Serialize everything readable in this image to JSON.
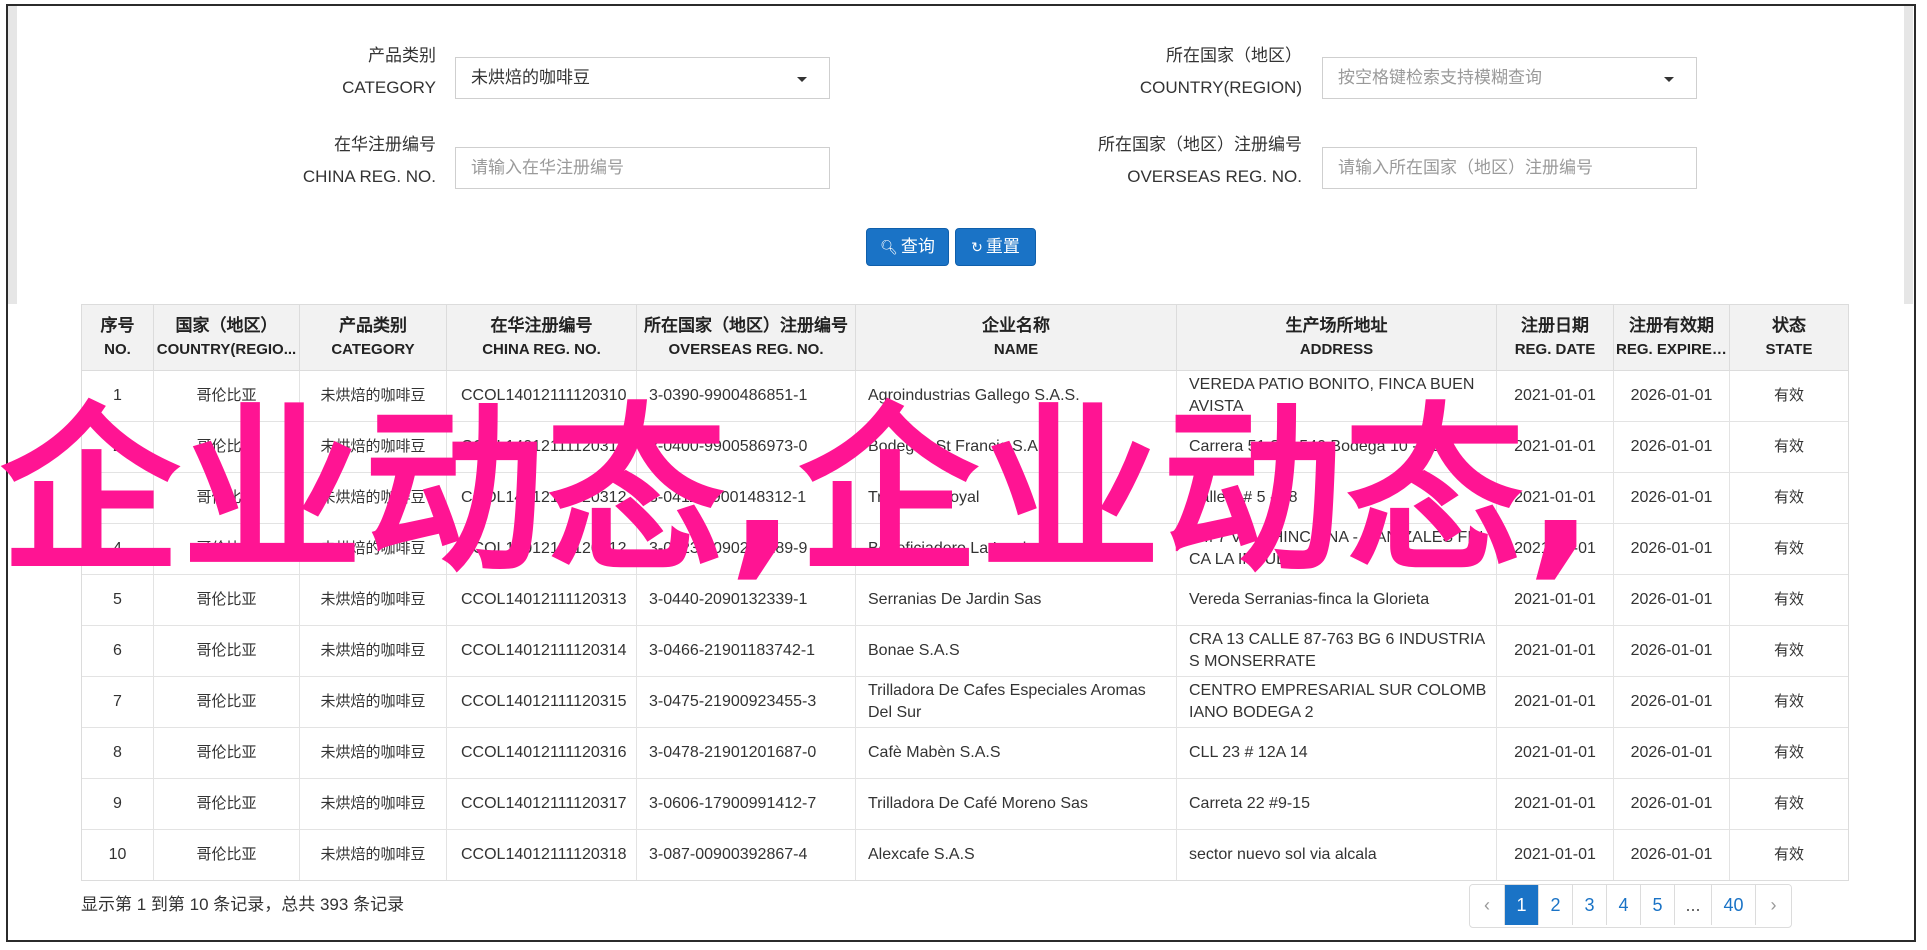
{
  "filters": {
    "category": {
      "label_zh": "产品类别",
      "label_en": "CATEGORY",
      "value": "未烘焙的咖啡豆"
    },
    "country": {
      "label_zh": "所在国家（地区）",
      "label_en": "COUNTRY(REGION)",
      "placeholder": "按空格键检索支持模糊查询"
    },
    "china_reg": {
      "label_zh": "在华注册编号",
      "label_en": "CHINA REG. NO.",
      "placeholder": "请输入在华注册编号"
    },
    "overseas_reg": {
      "label_zh": "所在国家（地区）注册编号",
      "label_en": "OVERSEAS REG. NO.",
      "placeholder": "请输入所在国家（地区）注册编号"
    }
  },
  "buttons": {
    "search": "查询",
    "reset": "重置"
  },
  "table": {
    "headers": [
      {
        "zh": "序号",
        "en": "NO."
      },
      {
        "zh": "国家（地区）",
        "en": "COUNTRY(REGIO..."
      },
      {
        "zh": "产品类别",
        "en": "CATEGORY"
      },
      {
        "zh": "在华注册编号",
        "en": "CHINA REG. NO."
      },
      {
        "zh": "所在国家（地区）注册编号",
        "en": "OVERSEAS REG. NO."
      },
      {
        "zh": "企业名称",
        "en": "NAME"
      },
      {
        "zh": "生产场所地址",
        "en": "ADDRESS"
      },
      {
        "zh": "注册日期",
        "en": "REG. DATE"
      },
      {
        "zh": "注册有效期",
        "en": "REG. EXPIRE ..."
      },
      {
        "zh": "状态",
        "en": "STATE"
      }
    ],
    "rows": [
      {
        "no": "1",
        "country": "哥伦比亚",
        "category": "未烘焙的咖啡豆",
        "china_reg": "CCOL14012111120310",
        "overseas_reg": "3-0390-9900486851-1",
        "name": "Agroindustrias Gallego S.A.S.",
        "address": "VEREDA PATIO BONITO, FINCA BUEN AVISTA",
        "reg_date": "2021-01-01",
        "expire": "2026-01-01",
        "state": "有效"
      },
      {
        "no": "2",
        "country": "哥伦比亚",
        "category": "未烘焙的咖啡豆",
        "china_reg": "CCOL14012111120311",
        "overseas_reg": "3-0400-9900586973-0",
        "name": "Bodegas St Francis S.A.S.",
        "address": "Carrera 51 Sur 540 Bodega 10 - 11",
        "reg_date": "2021-01-01",
        "expire": "2026-01-01",
        "state": "有效"
      },
      {
        "no": "3",
        "country": "哥伦比亚",
        "category": "未烘焙的咖啡豆",
        "china_reg": "CCOL14012111120312",
        "overseas_reg": "3-0411-9900148312-1",
        "name": "Trilladora Royal",
        "address": "Calle 6 # 5 - 28",
        "reg_date": "2021-01-01",
        "expire": "2026-01-01",
        "state": "有效"
      },
      {
        "no": "4",
        "country": "哥伦比亚",
        "category": "未烘焙的咖啡豆",
        "china_reg": "CCOL14012111120312",
        "overseas_reg": "3-0423-2090298289-9",
        "name": "Beneficiadero La Insula",
        "address": "KM 7 VIA CHINCHINA - MANIZALES FINCA LA INSULA",
        "reg_date": "2021-01-01",
        "expire": "2026-01-01",
        "state": "有效"
      },
      {
        "no": "5",
        "country": "哥伦比亚",
        "category": "未烘焙的咖啡豆",
        "china_reg": "CCOL14012111120313",
        "overseas_reg": "3-0440-2090132339-1",
        "name": "Serranias De Jardin Sas",
        "address": "Vereda Serranias-finca la Glorieta",
        "reg_date": "2021-01-01",
        "expire": "2026-01-01",
        "state": "有效"
      },
      {
        "no": "6",
        "country": "哥伦比亚",
        "category": "未烘焙的咖啡豆",
        "china_reg": "CCOL14012111120314",
        "overseas_reg": "3-0466-21901183742-1",
        "name": "Bonae S.A.S",
        "address": "CRA 13 CALLE 87-763 BG 6 INDUSTRIAS MONSERRATE",
        "reg_date": "2021-01-01",
        "expire": "2026-01-01",
        "state": "有效"
      },
      {
        "no": "7",
        "country": "哥伦比亚",
        "category": "未烘焙的咖啡豆",
        "china_reg": "CCOL14012111120315",
        "overseas_reg": "3-0475-21900923455-3",
        "name": "Trilladora De Cafes Especiales Aromas Del Sur",
        "address": "CENTRO EMPRESARIAL SUR COLOMBIANO BODEGA 2",
        "reg_date": "2021-01-01",
        "expire": "2026-01-01",
        "state": "有效"
      },
      {
        "no": "8",
        "country": "哥伦比亚",
        "category": "未烘焙的咖啡豆",
        "china_reg": "CCOL14012111120316",
        "overseas_reg": "3-0478-21901201687-0",
        "name": "Cafè Mabèn S.A.S",
        "address": "CLL 23 # 12A 14",
        "reg_date": "2021-01-01",
        "expire": "2026-01-01",
        "state": "有效"
      },
      {
        "no": "9",
        "country": "哥伦比亚",
        "category": "未烘焙的咖啡豆",
        "china_reg": "CCOL14012111120317",
        "overseas_reg": "3-0606-17900991412-7",
        "name": "Trilladora De Café Moreno Sas",
        "address": "Carreta 22 #9-15",
        "reg_date": "2021-01-01",
        "expire": "2026-01-01",
        "state": "有效"
      },
      {
        "no": "10",
        "country": "哥伦比亚",
        "category": "未烘焙的咖啡豆",
        "china_reg": "CCOL14012111120318",
        "overseas_reg": "3-087-00900392867-4",
        "name": "Alexcafe S.A.S",
        "address": "sector nuevo sol via alcala",
        "reg_date": "2021-01-01",
        "expire": "2026-01-01",
        "state": "有效"
      }
    ]
  },
  "summary": "显示第 1 到第 10 条记录，总共 393 条记录",
  "pagination": {
    "prev": "‹",
    "pages": [
      "1",
      "2",
      "3",
      "4",
      "5",
      "...",
      "40"
    ],
    "next": "›",
    "active": "1"
  },
  "watermark": "企业动态,企业动态,",
  "colors": {
    "primary": "#1a73c6",
    "watermark": "#ff1493"
  }
}
